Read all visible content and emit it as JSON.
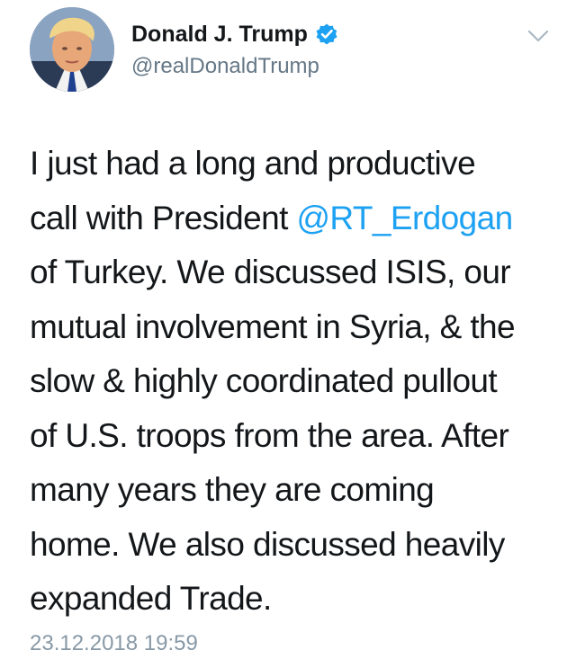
{
  "author": {
    "display_name": "Donald J. Trump",
    "handle": "@realDonaldTrump",
    "verified": true,
    "verified_color": "#1da1f2"
  },
  "tweet": {
    "lines": [
      "I just had a long and productive",
      "call with President ",
      "of Turkey. We discussed ISIS, our",
      "mutual involvement in Syria, & the",
      "slow & highly coordinated pullout",
      "of U.S. troops from the area. After",
      "many years they are coming",
      "home. We also discussed heavily",
      "expanded Trade."
    ],
    "mention": "@RT_Erdogan",
    "mention_color": "#1da1f2",
    "timestamp": "23.12.2018 19:59"
  },
  "icons": {
    "verified": "verified-badge-icon",
    "menu": "chevron-down-icon",
    "avatar": "profile-avatar"
  }
}
